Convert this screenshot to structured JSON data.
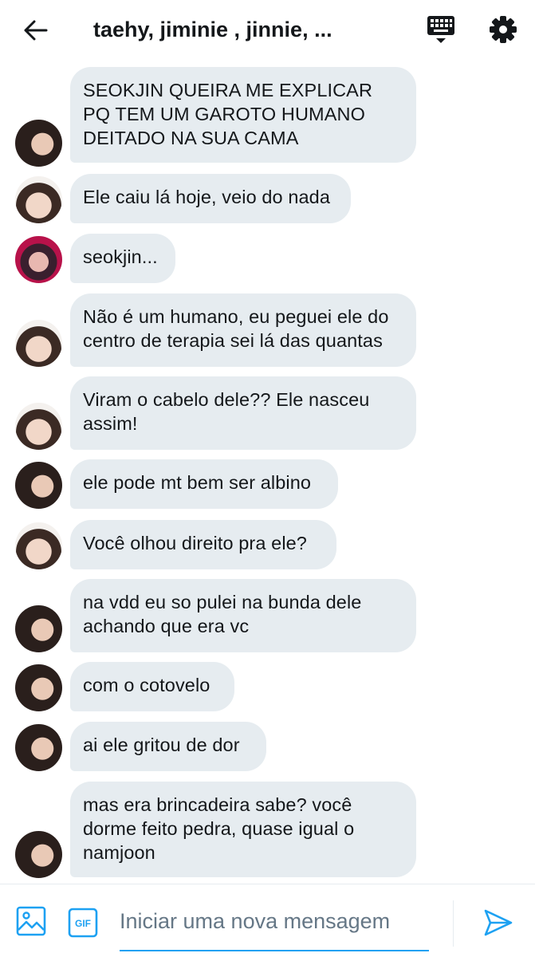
{
  "header": {
    "title": "taehy, jiminie , jinnie, ...",
    "back_icon": "arrow-left-icon",
    "keyboard_icon": "keyboard-icon",
    "settings_icon": "gear-icon"
  },
  "messages": [
    {
      "sender": "jimin",
      "text": "SEOKJIN QUEIRA ME EXPLICAR PQ TEM UM GAROTO HUMANO DEITADO NA SUA CAMA"
    },
    {
      "sender": "jin",
      "text": "Ele caiu lá hoje, veio do nada"
    },
    {
      "sender": "taehyung",
      "text": "seokjin..."
    },
    {
      "sender": "jin",
      "text": "Não é um humano, eu peguei ele do centro de terapia sei lá das quantas"
    },
    {
      "sender": "jin",
      "text": "Viram o cabelo dele?? Ele nasceu assim!"
    },
    {
      "sender": "jimin",
      "text": "ele pode mt bem ser albino"
    },
    {
      "sender": "jin",
      "text": "Você olhou direito pra ele?"
    },
    {
      "sender": "jimin",
      "text": "na vdd eu so pulei na bunda dele achando que era vc"
    },
    {
      "sender": "jimin",
      "text": "com o cotovelo"
    },
    {
      "sender": "jimin",
      "text": "ai ele gritou de dor"
    },
    {
      "sender": "jimin",
      "text": "mas era brincadeira sabe? você dorme feito pedra, quase igual o namjoon"
    }
  ],
  "composer": {
    "placeholder": "Iniciar uma nova mensagem",
    "value": "",
    "gif_label": "GIF",
    "media_icon": "image-icon",
    "send_icon": "send-icon"
  },
  "colors": {
    "bubble": "#e6ecf0",
    "accent": "#1da1f2",
    "text": "#14171a",
    "placeholder": "#657786"
  }
}
